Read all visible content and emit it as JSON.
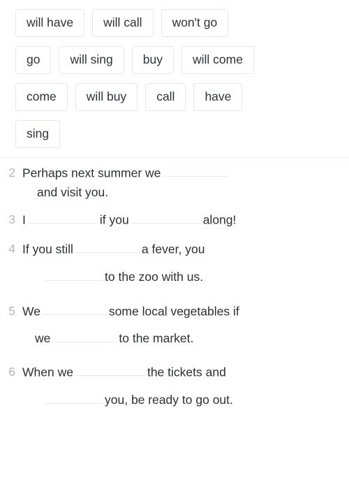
{
  "page": {
    "background": "#ffffff",
    "text_color": "#2d3033",
    "number_color": "#b4b8bc",
    "chip_border_color": "#e5e7e9",
    "blank_line_color": "#e9eaec"
  },
  "word_bank": {
    "rows": [
      {
        "chips": [
          {
            "label": "will have"
          },
          {
            "label": "will call"
          },
          {
            "label": "won't go"
          }
        ]
      },
      {
        "chips": [
          {
            "label": "go"
          },
          {
            "label": "will sing"
          },
          {
            "label": "buy"
          },
          {
            "label": "will come"
          }
        ]
      },
      {
        "chips": [
          {
            "label": "come"
          },
          {
            "label": "will buy"
          },
          {
            "label": "call"
          },
          {
            "label": "have"
          }
        ]
      },
      {
        "chips": [
          {
            "label": "sing"
          }
        ]
      }
    ]
  },
  "questions": [
    {
      "number": "2",
      "line1_a": "Perhaps next summer we",
      "line1_b": "",
      "line2_a": "and visit you."
    },
    {
      "number": "3",
      "line1_a": "I",
      "line1_b": "if you",
      "line1_c": "along!"
    },
    {
      "number": "4",
      "line1_a": "If you still",
      "line1_b": "a fever, you",
      "line2_a": "to the zoo with us."
    },
    {
      "number": "5",
      "line1_a": "We",
      "line1_b": "some local vegetables if",
      "line2_a": "we",
      "line2_b": "to the market."
    },
    {
      "number": "6",
      "line1_a": "When we",
      "line1_b": "the tickets and",
      "line2_a": "you, be ready to go out."
    }
  ]
}
